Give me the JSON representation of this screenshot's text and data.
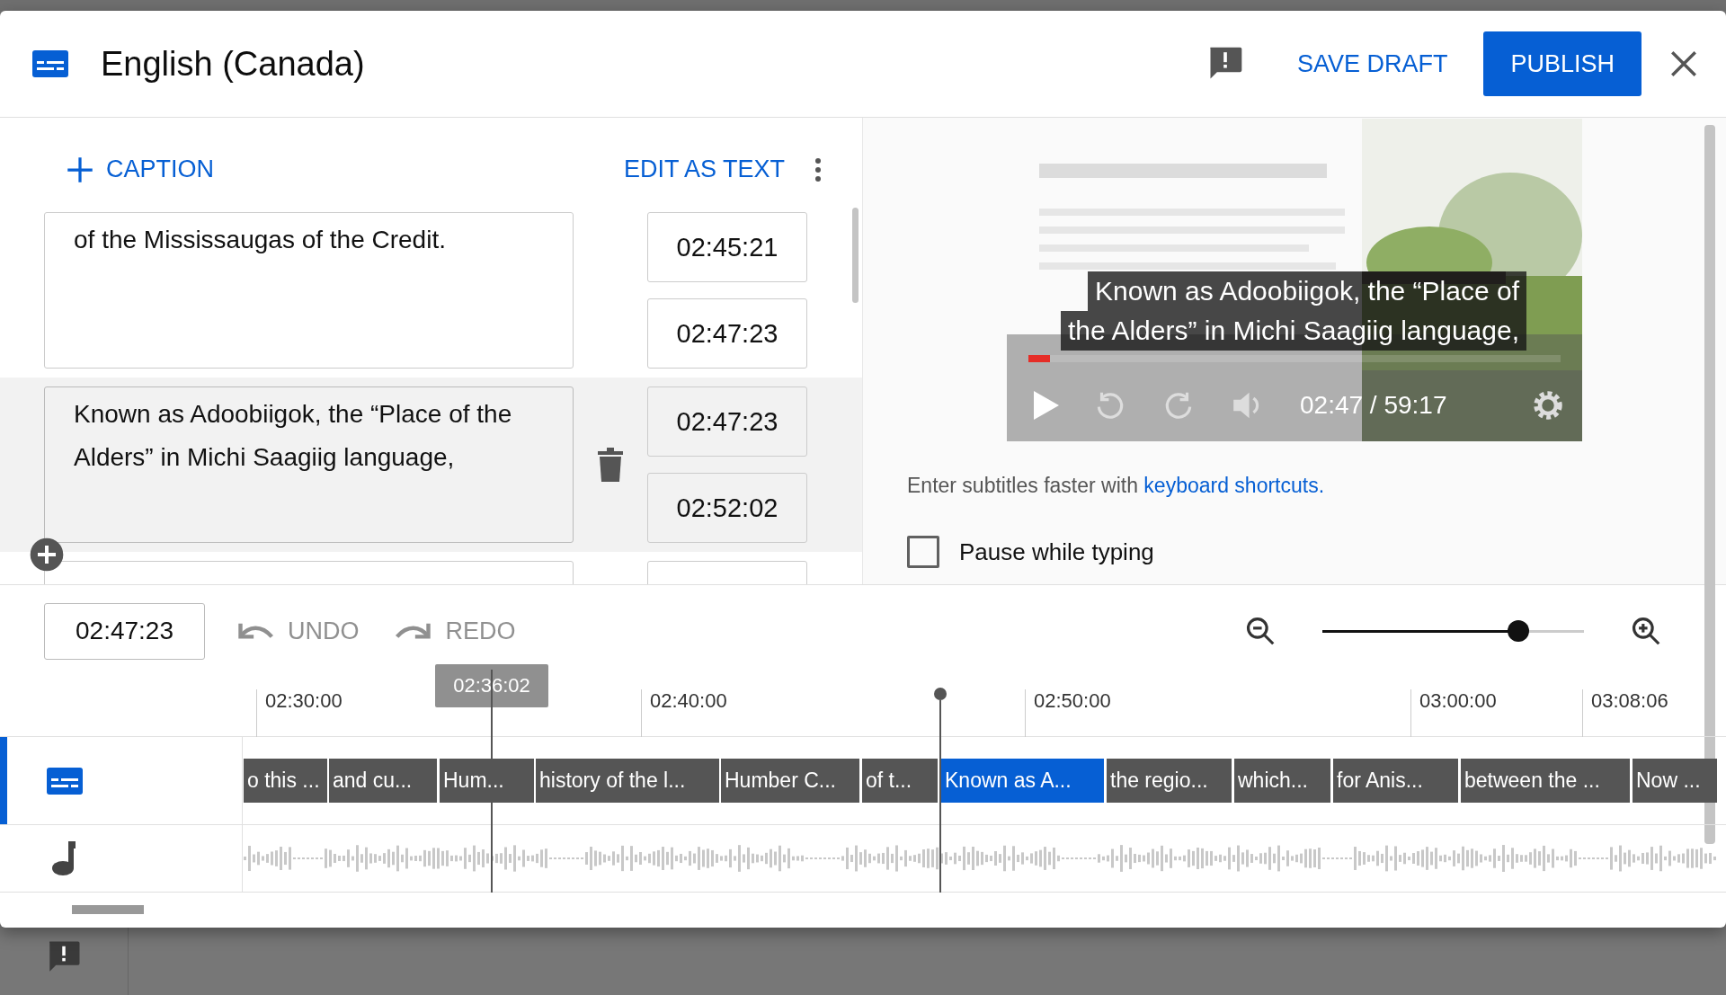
{
  "dialog": {
    "title": "English (Canada)",
    "save_draft": "SAVE DRAFT",
    "publish": "PUBLISH"
  },
  "editor": {
    "add_caption": "CAPTION",
    "edit_as_text": "EDIT AS TEXT",
    "captions": [
      {
        "text": "of the Mississaugas of the Credit.",
        "start": "02:45:21",
        "end": "02:47:23",
        "selected": false
      },
      {
        "text": "Known as Adoobiigok, the “Place of the Alders” in Michi Saagiig language,",
        "start": "02:47:23",
        "end": "02:52:02",
        "selected": true
      }
    ]
  },
  "preview": {
    "caption_lines": [
      "Known as Adoobiigok, the “Place of",
      "the Alders” in Michi Saagiig language,"
    ],
    "time": "02:47 / 59:17",
    "progress": {
      "level": 0.04
    },
    "hint": "Enter subtitles faster with",
    "hint_link": "keyboard shortcuts.",
    "pause_while_typing": {
      "label": "Pause while typing",
      "checked": false
    }
  },
  "toolbar": {
    "time": "02:47:23",
    "undo": {
      "label": "UNDO",
      "disabled": true
    },
    "redo": {
      "label": "REDO",
      "disabled": true
    },
    "zoom": {
      "level": 0.75
    }
  },
  "timeline": {
    "ruler": [
      "02:30:00",
      "02:40:00",
      "02:50:00",
      "03:00:00",
      "03:08:06"
    ],
    "hover_time": "02:36:02",
    "blocks": [
      {
        "text": "o this ...",
        "selected": false
      },
      {
        "text": "and cu...",
        "selected": false
      },
      {
        "text": "Hum...",
        "selected": false
      },
      {
        "text": "history of the l...",
        "selected": false
      },
      {
        "text": "Humber C...",
        "selected": false
      },
      {
        "text": "of t...",
        "selected": false
      },
      {
        "text": "Known as A...",
        "selected": true
      },
      {
        "text": "the regio...",
        "selected": false
      },
      {
        "text": "which...",
        "selected": false
      },
      {
        "text": "for Anis...",
        "selected": false
      },
      {
        "text": "between the ...",
        "selected": false
      },
      {
        "text": "Now ...",
        "selected": false
      }
    ]
  }
}
